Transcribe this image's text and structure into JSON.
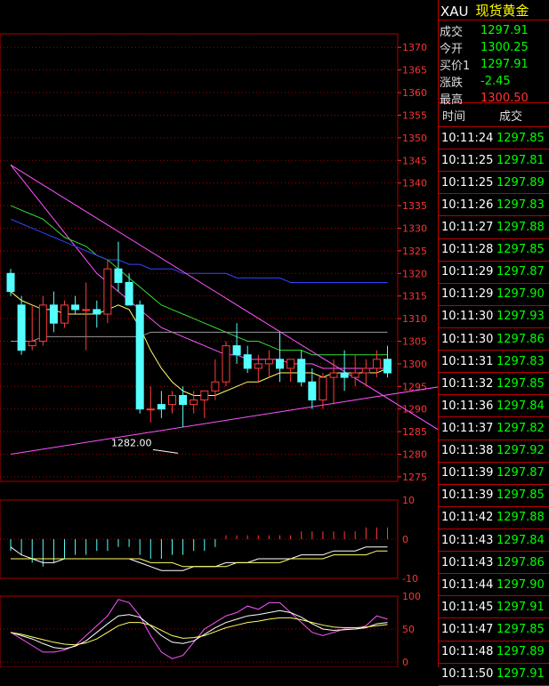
{
  "colors": {
    "up": "#ff3b3b",
    "down": "#55ffff",
    "ma5": "#ffffff",
    "ma10": "#ffff66",
    "ma20": "#ff55ff",
    "ma40": "#33dd33",
    "ma60": "#3344ff",
    "ma120": "#999999",
    "trend": "#ff55ff",
    "grid": "#aa0000",
    "axis": "#ff3333",
    "up_text": "#00ff00",
    "down_text": "#ff3333"
  },
  "header": {
    "symbol": "XAU",
    "name": "现货黄金"
  },
  "quotes": [
    {
      "label": "成交",
      "value": "1297.91",
      "color": "#00ff00"
    },
    {
      "label": "今开",
      "value": "1300.25",
      "color": "#00ff00"
    },
    {
      "label": "买价1",
      "value": "1297.91",
      "color": "#00ff00"
    },
    {
      "label": "涨跌",
      "value": "-2.45",
      "color": "#00ff00"
    },
    {
      "label": "最高",
      "value": "1300.50",
      "color": "#ff3333"
    }
  ],
  "ticks_header": {
    "time": "时间",
    "price": "成交"
  },
  "ticks": [
    {
      "time": "10:11:24",
      "price": "1297.85"
    },
    {
      "time": "10:11:25",
      "price": "1297.81"
    },
    {
      "time": "10:11:25",
      "price": "1297.89"
    },
    {
      "time": "10:11:26",
      "price": "1297.83"
    },
    {
      "time": "10:11:27",
      "price": "1297.88"
    },
    {
      "time": "10:11:28",
      "price": "1297.85"
    },
    {
      "time": "10:11:29",
      "price": "1297.87"
    },
    {
      "time": "10:11:29",
      "price": "1297.90"
    },
    {
      "time": "10:11:30",
      "price": "1297.93"
    },
    {
      "time": "10:11:30",
      "price": "1297.86"
    },
    {
      "time": "10:11:31",
      "price": "1297.83"
    },
    {
      "time": "10:11:32",
      "price": "1297.85"
    },
    {
      "time": "10:11:36",
      "price": "1297.84"
    },
    {
      "time": "10:11:37",
      "price": "1297.82"
    },
    {
      "time": "10:11:38",
      "price": "1297.92"
    },
    {
      "time": "10:11:39",
      "price": "1297.87"
    },
    {
      "time": "10:11:39",
      "price": "1297.85"
    },
    {
      "time": "10:11:42",
      "price": "1297.88"
    },
    {
      "time": "10:11:43",
      "price": "1297.84"
    },
    {
      "time": "10:11:43",
      "price": "1297.86"
    },
    {
      "time": "10:11:44",
      "price": "1297.90"
    },
    {
      "time": "10:11:45",
      "price": "1297.91"
    },
    {
      "time": "10:11:47",
      "price": "1297.85"
    },
    {
      "time": "10:11:48",
      "price": "1297.89"
    },
    {
      "time": "10:11:50",
      "price": "1297.91"
    }
  ],
  "chart_data": [
    {
      "type": "candlestick",
      "yticks": [
        1275,
        1280,
        1285,
        1290,
        1295,
        1300,
        1305,
        1310,
        1315,
        1320,
        1325,
        1330,
        1335,
        1340,
        1345,
        1350,
        1355,
        1360,
        1365,
        1370
      ],
      "ylim": [
        1274,
        1373
      ],
      "annotation": {
        "text": "1282.00",
        "value": 1282.0
      },
      "candles": [
        [
          1320,
          1321,
          1315,
          1316
        ],
        [
          1313,
          1315,
          1302,
          1303
        ],
        [
          1304,
          1313,
          1303,
          1305
        ],
        [
          1305,
          1315,
          1304,
          1313
        ],
        [
          1313,
          1316,
          1307,
          1309
        ],
        [
          1309,
          1314,
          1308,
          1313
        ],
        [
          1313,
          1315,
          1311,
          1312
        ],
        [
          1312,
          1318,
          1303,
          1312
        ],
        [
          1312,
          1314,
          1308,
          1311
        ],
        [
          1311,
          1323,
          1309,
          1321
        ],
        [
          1321,
          1327,
          1316,
          1318
        ],
        [
          1318,
          1320,
          1313,
          1313
        ],
        [
          1313,
          1314,
          1289,
          1290
        ],
        [
          1290,
          1295,
          1287,
          1290
        ],
        [
          1291,
          1294,
          1288,
          1290
        ],
        [
          1291,
          1294,
          1289,
          1293
        ],
        [
          1293,
          1295,
          1286,
          1291
        ],
        [
          1291,
          1294,
          1289,
          1292
        ],
        [
          1292,
          1294,
          1288,
          1294
        ],
        [
          1294,
          1301,
          1292,
          1296
        ],
        [
          1296,
          1305,
          1295,
          1304
        ],
        [
          1304,
          1309,
          1300,
          1302
        ],
        [
          1302,
          1304,
          1298,
          1299
        ],
        [
          1299,
          1302,
          1296,
          1300
        ],
        [
          1300,
          1303,
          1297,
          1301
        ],
        [
          1301,
          1307,
          1296,
          1299
        ],
        [
          1299,
          1301,
          1296,
          1301
        ],
        [
          1301,
          1303,
          1295,
          1296
        ],
        [
          1296,
          1299,
          1290,
          1292
        ],
        [
          1292,
          1298,
          1290,
          1297
        ],
        [
          1297,
          1301,
          1291,
          1298
        ],
        [
          1298,
          1303,
          1294,
          1297
        ],
        [
          1297,
          1302,
          1295,
          1298
        ],
        [
          1298,
          1301,
          1295,
          1299
        ],
        [
          1299,
          1303,
          1297,
          1301
        ],
        [
          1301,
          1304,
          1297,
          1298
        ]
      ],
      "ma_lines": {
        "ma10": [
          1316,
          1314,
          1313,
          1312,
          1312,
          1311,
          1311,
          1311,
          1311,
          1312,
          1313,
          1312,
          1308,
          1303,
          1299,
          1296,
          1294,
          1293,
          1293,
          1293,
          1294,
          1295,
          1296,
          1296,
          1297,
          1298,
          1298,
          1298,
          1298,
          1297,
          1298,
          1298,
          1298,
          1298,
          1298,
          1299
        ],
        "ma20": [
          1344,
          1341,
          1338,
          1335,
          1332,
          1329,
          1326,
          1323,
          1320,
          1318,
          1316,
          1314,
          1312,
          1310,
          1308,
          1307,
          1306,
          1305,
          1304,
          1303,
          1302,
          1302,
          1301,
          1301,
          1301,
          1301,
          1300,
          1300,
          1300,
          1299,
          1299,
          1299,
          1299,
          1299,
          1299,
          1299
        ],
        "ma40": [
          1335,
          1334,
          1333,
          1332,
          1330,
          1328,
          1327,
          1326,
          1324,
          1323,
          1321,
          1319,
          1317,
          1315,
          1313,
          1312,
          1311,
          1310,
          1309,
          1308,
          1307,
          1306,
          1305,
          1305,
          1304,
          1303,
          1303,
          1303,
          1302,
          1302,
          1302,
          1302,
          1302,
          1302,
          1302,
          1302
        ],
        "ma60": [
          1332,
          1331,
          1330,
          1329,
          1328,
          1327,
          1326,
          1325,
          1324,
          1323,
          1323,
          1322,
          1322,
          1321,
          1321,
          1321,
          1320,
          1320,
          1320,
          1320,
          1320,
          1319,
          1319,
          1319,
          1319,
          1319,
          1318,
          1318,
          1318,
          1318,
          1318,
          1318,
          1318,
          1318,
          1318,
          1318
        ],
        "ma120": [
          1305,
          1305,
          1305,
          1306,
          1306,
          1306,
          1306,
          1306,
          1306,
          1306,
          1306,
          1306,
          1306,
          1307,
          1307,
          1307,
          1307,
          1307,
          1307,
          1307,
          1307,
          1307,
          1307,
          1307,
          1307,
          1307,
          1307,
          1307,
          1307,
          1307,
          1307,
          1307,
          1307,
          1307,
          1307,
          1307
        ]
      },
      "trendlines": [
        {
          "from": [
            0,
            1280
          ],
          "to": [
            40,
            1295
          ]
        },
        {
          "from": [
            0,
            1344
          ],
          "to": [
            40,
            1285
          ]
        }
      ]
    },
    {
      "type": "bar",
      "yticks": [
        -10,
        0,
        10
      ],
      "ylim": [
        -10,
        10
      ],
      "bars": [
        -3,
        -4,
        -6,
        -7,
        -6,
        -5,
        -4,
        -4,
        -3,
        -3,
        -2,
        -2,
        -4,
        -5,
        -5,
        -4,
        -4,
        -3,
        -3,
        -2,
        1,
        1,
        1,
        1,
        1,
        1,
        1,
        2,
        2,
        2,
        2,
        2,
        2,
        3,
        3,
        3
      ],
      "lines": {
        "dif": [
          -2,
          -4,
          -5,
          -6,
          -6,
          -5,
          -5,
          -5,
          -5,
          -5,
          -5,
          -5,
          -6,
          -7,
          -8,
          -8,
          -8,
          -7,
          -7,
          -7,
          -6,
          -6,
          -6,
          -5,
          -5,
          -5,
          -5,
          -4,
          -4,
          -4,
          -3,
          -3,
          -3,
          -2,
          -2,
          -2
        ],
        "dea": [
          -5,
          -5,
          -5,
          -5,
          -5,
          -5,
          -5,
          -5,
          -5,
          -5,
          -5,
          -5,
          -5,
          -6,
          -6,
          -6,
          -7,
          -7,
          -7,
          -7,
          -7,
          -6,
          -6,
          -6,
          -6,
          -6,
          -5,
          -5,
          -5,
          -5,
          -4,
          -4,
          -4,
          -4,
          -3,
          -3
        ]
      }
    },
    {
      "type": "line",
      "yticks": [
        0,
        50,
        100
      ],
      "ylim": [
        0,
        100
      ],
      "series": [
        {
          "color": "#ff55ff",
          "values": [
            45,
            35,
            25,
            15,
            15,
            18,
            25,
            40,
            55,
            70,
            95,
            90,
            70,
            40,
            15,
            5,
            10,
            30,
            50,
            60,
            70,
            75,
            85,
            80,
            90,
            90,
            75,
            60,
            45,
            40,
            45,
            50,
            50,
            55,
            70,
            65
          ]
        },
        {
          "color": "#ffffff",
          "values": [
            45,
            40,
            35,
            28,
            22,
            20,
            24,
            32,
            45,
            58,
            70,
            72,
            68,
            55,
            40,
            30,
            28,
            32,
            42,
            52,
            60,
            65,
            70,
            72,
            75,
            78,
            75,
            68,
            58,
            50,
            48,
            49,
            50,
            52,
            58,
            60
          ]
        },
        {
          "color": "#ffff66",
          "values": [
            45,
            42,
            38,
            34,
            30,
            27,
            26,
            29,
            35,
            45,
            55,
            60,
            60,
            56,
            48,
            40,
            36,
            37,
            40,
            46,
            52,
            56,
            60,
            62,
            65,
            67,
            67,
            64,
            60,
            56,
            53,
            52,
            52,
            53,
            55,
            57
          ]
        }
      ]
    }
  ]
}
